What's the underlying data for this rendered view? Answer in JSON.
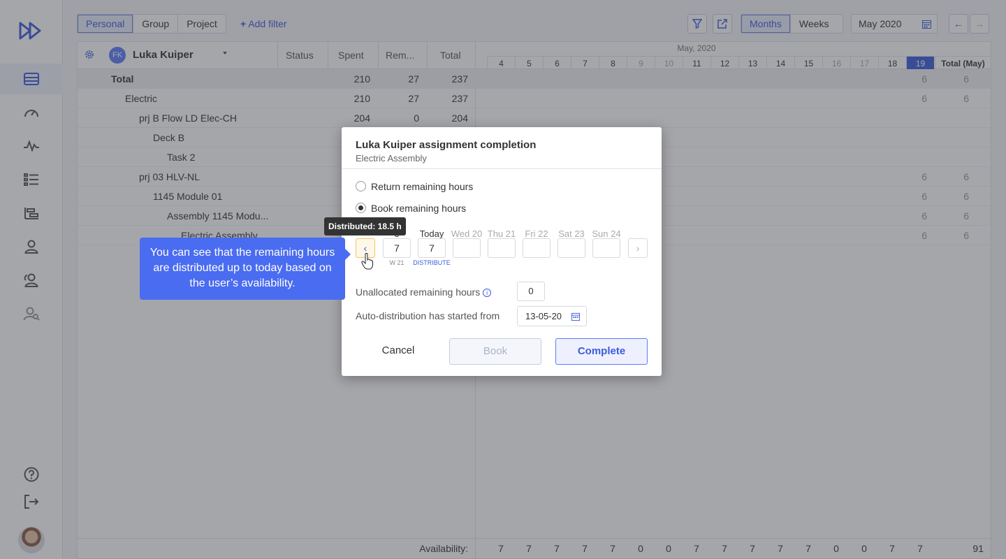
{
  "toolbar": {
    "scope_tabs": [
      "Personal",
      "Group",
      "Project"
    ],
    "add_filter": "Add filter",
    "range_tabs": [
      "Months",
      "Weeks"
    ],
    "period": "May 2020"
  },
  "grid": {
    "user_initials": "FK",
    "user_name": "Luka Kuiper",
    "columns": {
      "status": "Status",
      "spent": "Spent",
      "remaining": "Rem...",
      "total": "Total"
    },
    "month_label": "May, 2020",
    "days": [
      "4",
      "5",
      "6",
      "7",
      "8",
      "9",
      "10",
      "11",
      "12",
      "13",
      "14",
      "15",
      "16",
      "17",
      "18",
      "19"
    ],
    "total_col": "Total (May)",
    "rows": [
      {
        "label": "Total",
        "spent": "210",
        "rem": "27",
        "total": "237",
        "d19": "6",
        "tm": "6"
      },
      {
        "label": "Electric",
        "spent": "210",
        "rem": "27",
        "total": "237",
        "d19": "6",
        "tm": "6"
      },
      {
        "label": "prj B Flow LD Elec-CH",
        "spent": "204",
        "rem": "0",
        "total": "204",
        "d19": "",
        "tm": ""
      },
      {
        "label": "Deck B",
        "spent": "",
        "rem": "",
        "total": "",
        "d19": "",
        "tm": ""
      },
      {
        "label": "Task 2",
        "spent": "",
        "rem": "",
        "total": "",
        "d19": "",
        "tm": ""
      },
      {
        "label": "prj 03 HLV-NL",
        "spent": "",
        "rem": "",
        "total": "",
        "d19": "6",
        "tm": "6"
      },
      {
        "label": "1145 Module 01",
        "spent": "",
        "rem": "",
        "total": "",
        "d19": "6",
        "tm": "6"
      },
      {
        "label": "Assembly 1145 Modu...",
        "spent": "",
        "rem": "",
        "total": "",
        "d19": "6",
        "tm": "6"
      },
      {
        "label": "Electric Assembly",
        "spent": "",
        "rem": "",
        "total": "",
        "d19": "6",
        "tm": "6"
      }
    ],
    "availability_label": "Availability:",
    "availability": [
      "7",
      "7",
      "7",
      "7",
      "7",
      "0",
      "0",
      "7",
      "7",
      "7",
      "7",
      "7",
      "0",
      "0",
      "7",
      "7"
    ],
    "availability_total": "91"
  },
  "modal": {
    "title": "Luka Kuiper assignment completion",
    "subtitle": "Electric Assembly",
    "option_return": "Return remaining hours",
    "option_book": "Book remaining hours",
    "days": [
      {
        "label": "3",
        "value": "7",
        "sub": "W 21"
      },
      {
        "label": "Today",
        "value": "7",
        "sub": "DISTRIBUTE"
      },
      {
        "label": "Wed 20",
        "value": "",
        "sub": ""
      },
      {
        "label": "Thu 21",
        "value": "",
        "sub": ""
      },
      {
        "label": "Fri 22",
        "value": "",
        "sub": ""
      },
      {
        "label": "Sat 23",
        "value": "",
        "sub": ""
      },
      {
        "label": "Sun 24",
        "value": "",
        "sub": ""
      }
    ],
    "unallocated_label": "Unallocated remaining hours",
    "unallocated_value": "0",
    "autodist_label": "Auto-distribution has started from",
    "autodist_value": "13-05-20",
    "cancel": "Cancel",
    "book": "Book",
    "complete": "Complete"
  },
  "tooltip": "Distributed: 18.5 h",
  "tour_text": "You can see that the remaining hours are distributed up to today based on the user’s availability.",
  "colors": {
    "accent": "#3b5bdb",
    "tour": "#4a6cf0"
  }
}
